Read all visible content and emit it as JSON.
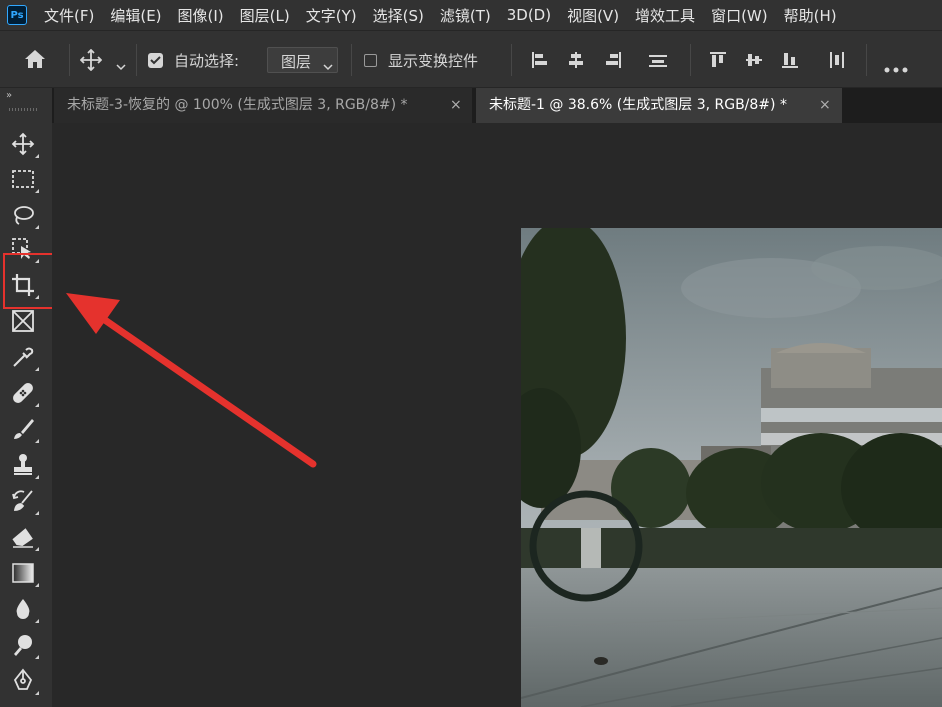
{
  "app": {
    "logo_text": "Ps"
  },
  "menu": {
    "items": [
      "文件(F)",
      "编辑(E)",
      "图像(I)",
      "图层(L)",
      "文字(Y)",
      "选择(S)",
      "滤镜(T)",
      "3D(D)",
      "视图(V)",
      "增效工具",
      "窗口(W)",
      "帮助(H)"
    ]
  },
  "options": {
    "home_icon": "home-icon",
    "move_icon": "move-icon",
    "auto_select_label": "自动选择:",
    "auto_select_checked": true,
    "auto_select_target": "图层",
    "show_transform_label": "显示变换控件",
    "show_transform_checked": false,
    "more_icon": "more-icon"
  },
  "tabs": [
    {
      "title": "未标题-3-恢复的 @ 100% (生成式图层 3, RGB/8#) *",
      "active": false
    },
    {
      "title": "未标题-1 @ 38.6% (生成式图层 3, RGB/8#) *",
      "active": true
    }
  ],
  "tab_close_glyph": "×",
  "toolbar": {
    "collapse_glyph": "»",
    "tools": [
      "move-tool",
      "marquee-tool",
      "lasso-tool",
      "object-select-tool",
      "crop-tool",
      "frame-tool",
      "eyedropper-tool",
      "healing-brush-tool",
      "brush-tool",
      "clone-stamp-tool",
      "history-brush-tool",
      "eraser-tool",
      "gradient-tool",
      "blur-tool",
      "dodge-tool",
      "pen-tool"
    ],
    "highlighted_tool": "crop-tool"
  },
  "colors": {
    "annotation": "#e5322d",
    "ps_blue": "#31a8ff",
    "panel": "#323232",
    "canvas_bg": "#282828"
  }
}
